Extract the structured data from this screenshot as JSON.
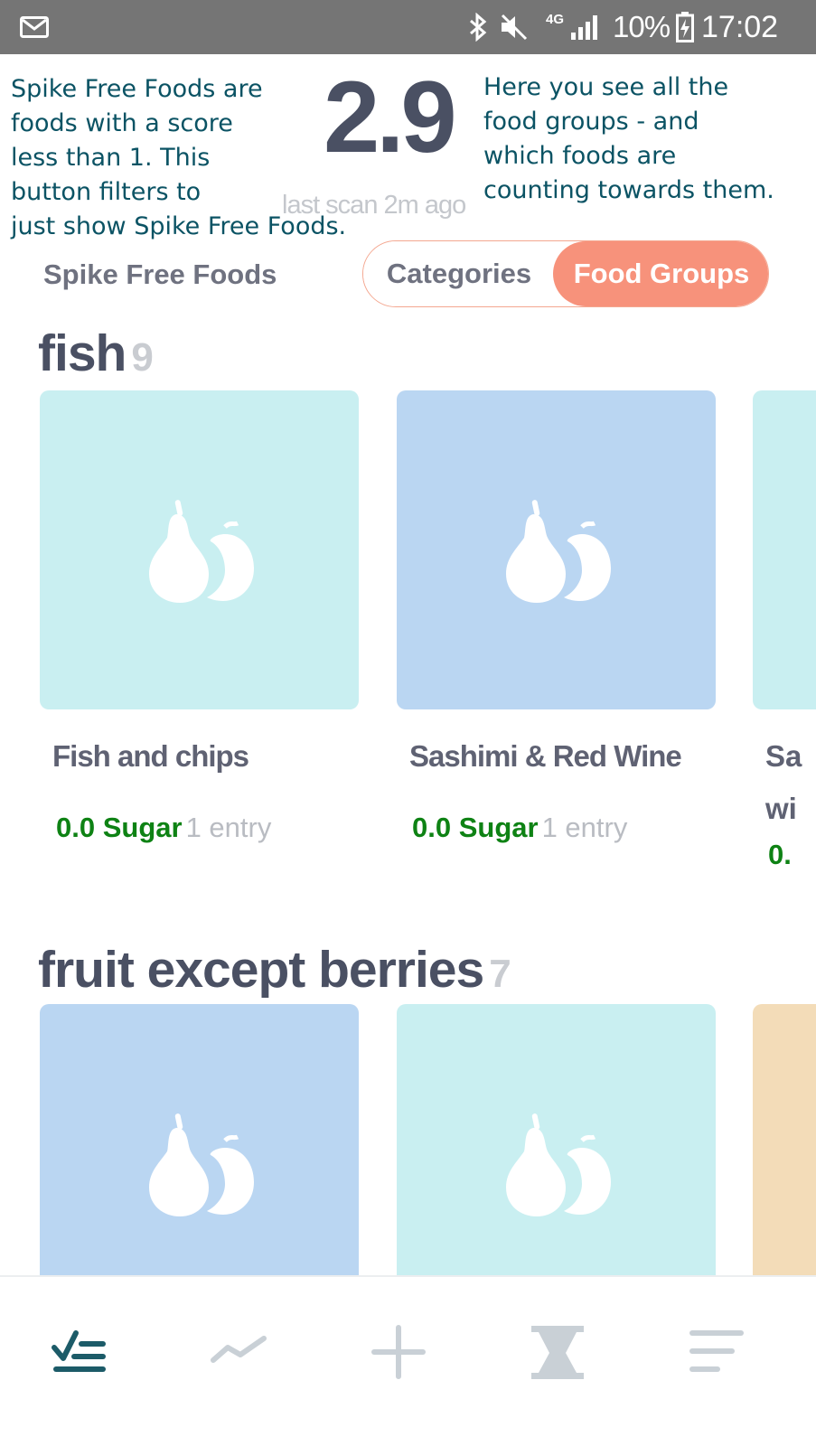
{
  "status_bar": {
    "network_type": "4G",
    "battery_percent": "10%",
    "time": "17:02",
    "icons": [
      "mail-icon",
      "bluetooth-icon",
      "mute-icon",
      "signal-icon",
      "battery-charging-icon"
    ]
  },
  "annotations": {
    "left": [
      "Spike Free Foods are",
      "foods with a score",
      "less than 1. This",
      "button filters to",
      "just show Spike Free Foods."
    ],
    "right": [
      "Here you see all the",
      "food groups - and",
      "which foods are",
      "counting towards them."
    ]
  },
  "header": {
    "score": "2.9",
    "last_scan": "last scan 2m ago"
  },
  "filters": {
    "spike_free_label": "Spike Free Foods",
    "categories_label": "Categories",
    "food_groups_label": "Food Groups",
    "active": "Food Groups"
  },
  "sections": [
    {
      "title": "fish",
      "count": "9",
      "items": [
        {
          "name": "Fish and chips",
          "score": "0.0 Sugar",
          "entries": "1 entry",
          "color": "#c9eff1"
        },
        {
          "name": "Sashimi & Red Wine",
          "score": "0.0 Sugar",
          "entries": "1 entry",
          "color": "#bad6f2"
        }
      ],
      "partial_item": {
        "name_fragments": [
          "Sa",
          "wi"
        ],
        "score_fragment": "0.",
        "color": "#c9eff1"
      }
    },
    {
      "title": "fruit except berries",
      "count": "7",
      "items": [
        {
          "color": "#bad6f2"
        },
        {
          "color": "#c9eff1"
        }
      ],
      "partial_item": {
        "color": "#f3dcb8"
      }
    }
  ],
  "bottom_nav": [
    {
      "icon": "checklist-icon",
      "active": true
    },
    {
      "icon": "trend-line-icon",
      "active": false
    },
    {
      "icon": "plus-icon",
      "active": false
    },
    {
      "icon": "hourglass-icon",
      "active": false
    },
    {
      "icon": "menu-lines-icon",
      "active": false
    }
  ],
  "colors": {
    "accent": "#f7927b",
    "annotation_text": "#0b5364",
    "sugar_green": "#0e8214",
    "nav_active": "#1c5b68",
    "nav_inactive": "#c9d0d6"
  }
}
